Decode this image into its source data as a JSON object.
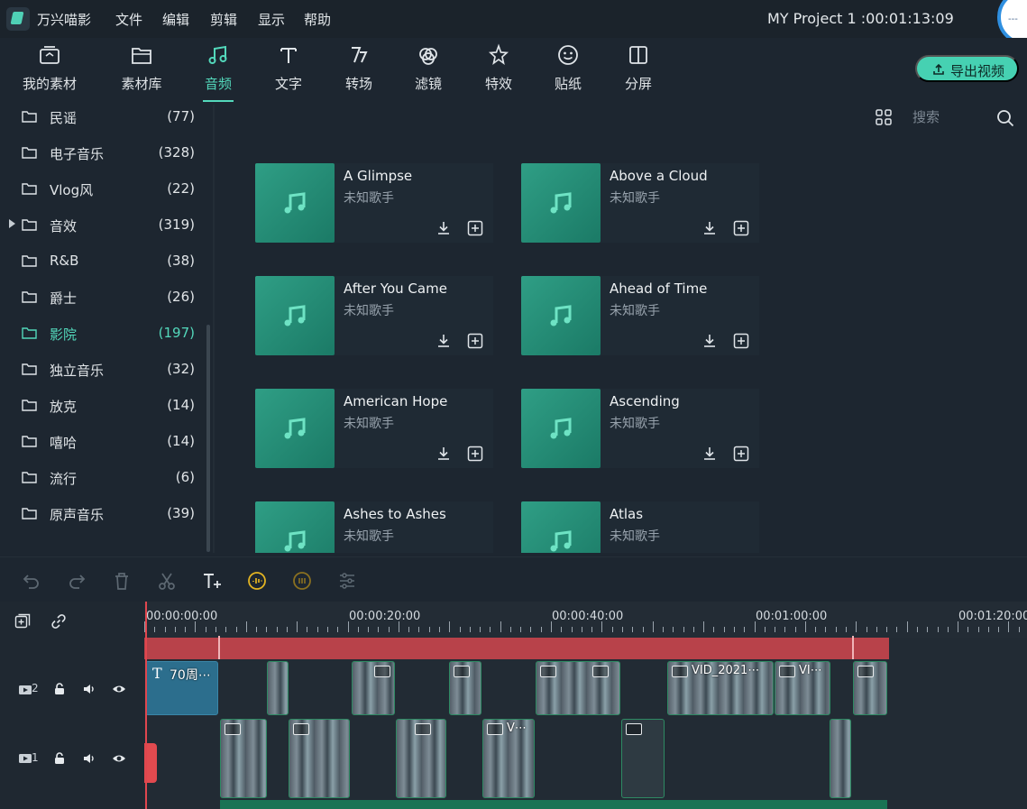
{
  "app": {
    "name": "万兴喵影",
    "project_title": "MY Project 1 :00:01:13:09",
    "corner_badge": "---"
  },
  "menu": [
    "文件",
    "编辑",
    "剪辑",
    "显示",
    "帮助"
  ],
  "tabs": [
    {
      "label": "我的素材",
      "icon": "folder-media-icon"
    },
    {
      "label": "素材库",
      "icon": "library-icon"
    },
    {
      "label": "音频",
      "icon": "music-note-icon",
      "active": true
    },
    {
      "label": "文字",
      "icon": "text-icon"
    },
    {
      "label": "转场",
      "icon": "transition-icon"
    },
    {
      "label": "滤镜",
      "icon": "filter-icon"
    },
    {
      "label": "特效",
      "icon": "effect-icon"
    },
    {
      "label": "贴纸",
      "icon": "sticker-icon"
    },
    {
      "label": "分屏",
      "icon": "split-screen-icon"
    }
  ],
  "export": {
    "label": "导出视频"
  },
  "search": {
    "placeholder": "搜索"
  },
  "categories": [
    {
      "name": "民谣",
      "count": "(77)"
    },
    {
      "name": "电子音乐",
      "count": "(328)"
    },
    {
      "name": "Vlog风",
      "count": "(22)"
    },
    {
      "name": "音效",
      "count": "(319)",
      "expandable": true
    },
    {
      "name": "R&B",
      "count": "(38)"
    },
    {
      "name": "爵士",
      "count": "(26)"
    },
    {
      "name": "影院",
      "count": "(197)",
      "active": true
    },
    {
      "name": "独立音乐",
      "count": "(32)"
    },
    {
      "name": "放克",
      "count": "(14)"
    },
    {
      "name": "嘻哈",
      "count": "(14)"
    },
    {
      "name": "流行",
      "count": "(6)"
    },
    {
      "name": "原声音乐",
      "count": "(39)"
    }
  ],
  "tracks": [
    {
      "title": "A Glimpse",
      "artist": "未知歌手"
    },
    {
      "title": "Above a Cloud",
      "artist": "未知歌手"
    },
    {
      "title": "After You Came",
      "artist": "未知歌手"
    },
    {
      "title": "Ahead of Time",
      "artist": "未知歌手"
    },
    {
      "title": "American Hope",
      "artist": "未知歌手"
    },
    {
      "title": "Ascending",
      "artist": "未知歌手"
    },
    {
      "title": "Ashes to Ashes",
      "artist": "未知歌手"
    },
    {
      "title": "Atlas",
      "artist": "未知歌手"
    }
  ],
  "timeline": {
    "ruler": [
      "00:00:00:00",
      "00:00:20:00",
      "00:00:40:00",
      "00:01:00:00",
      "00:01:20:00"
    ],
    "track_labels": [
      "2",
      "1"
    ],
    "title_clip": "70周⋯",
    "clip_labels": {
      "v1": "VID_2021⋯",
      "v2": "VI⋯",
      "v3": "V⋯"
    }
  },
  "colors": {
    "accent": "#53d8bb",
    "export_bg": "#46d1b2",
    "playhead": "#e0464e",
    "render_bar": "#b8424a"
  }
}
